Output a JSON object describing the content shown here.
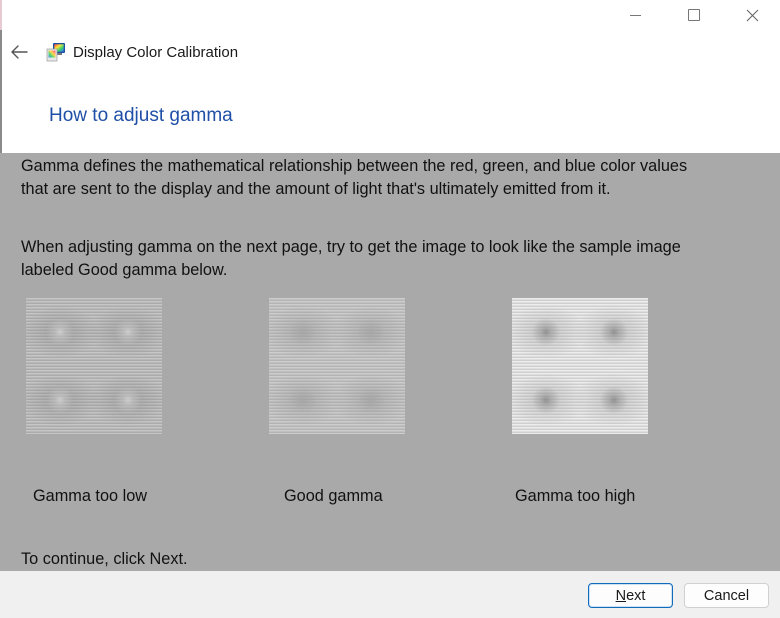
{
  "window": {
    "app_title": "Display Color Calibration",
    "caption_buttons": {
      "minimize": "minimize-icon",
      "maximize": "maximize-icon",
      "close": "close-icon"
    },
    "back_icon": "back-arrow-icon",
    "app_icon": "display-color-calibration-icon"
  },
  "page": {
    "heading": "How to adjust gamma",
    "paragraph1_line1": "Gamma defines the mathematical relationship between the red, green, and blue color values",
    "paragraph1_line2": "that are sent to the display and the amount of light that's ultimately emitted from it.",
    "paragraph2_line1": "When adjusting gamma on the next page, try to get the image to look like the sample image",
    "paragraph2_line2": "labeled Good gamma below.",
    "samples": [
      {
        "label": "Gamma too low",
        "type": "low"
      },
      {
        "label": "Good gamma",
        "type": "good"
      },
      {
        "label": "Gamma too high",
        "type": "high"
      }
    ],
    "continue_text": "To continue, click Next."
  },
  "footer": {
    "next_mnemonic": "N",
    "next_rest": "ext",
    "cancel_label": "Cancel"
  },
  "colors": {
    "heading": "#1f4fa6",
    "content_bg": "#a9a9a9",
    "footer_bg": "#f0f0f0",
    "accent": "#0f6cbd"
  }
}
